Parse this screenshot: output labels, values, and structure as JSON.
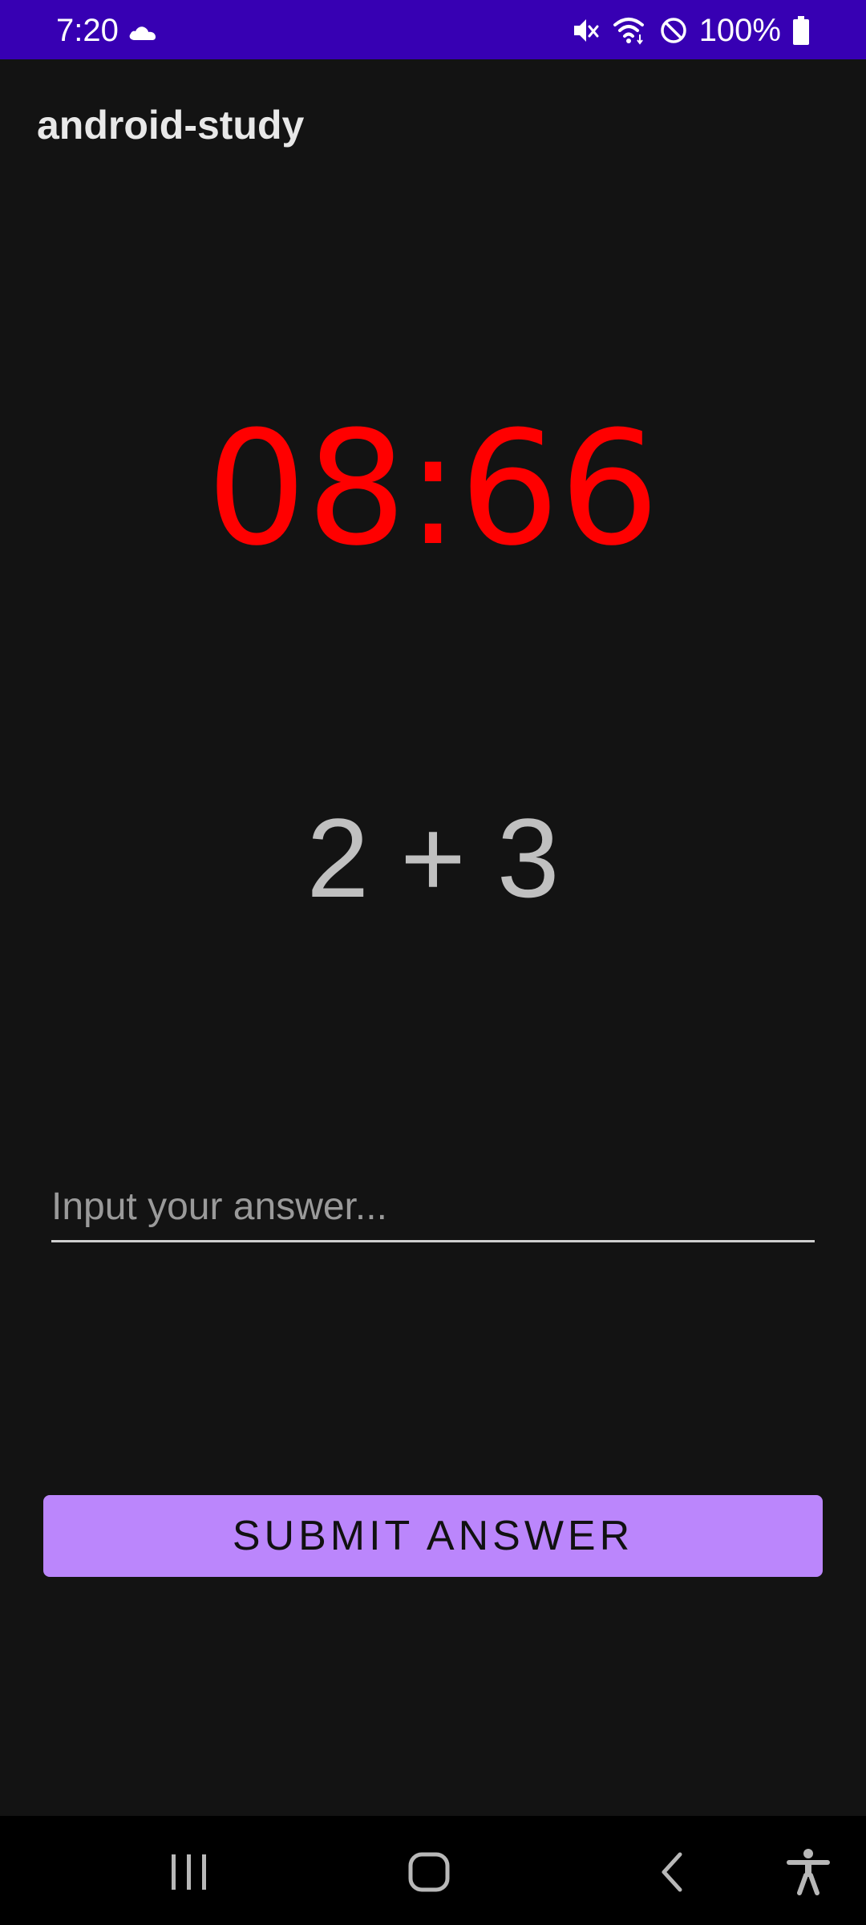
{
  "status_bar": {
    "time": "7:20",
    "battery": "100%",
    "background": "#3700b3",
    "icons": [
      "cloud-icon",
      "mute-icon",
      "wifi-icon",
      "do-not-disturb-icon",
      "battery-icon"
    ]
  },
  "app": {
    "title": "android-study"
  },
  "game": {
    "timer": "08:66",
    "timer_color": "#ff0000",
    "question": "2 + 3"
  },
  "answer": {
    "value": "",
    "placeholder": "Input your answer..."
  },
  "submit": {
    "label": "SUBMIT ANSWER",
    "color": "#bb86fc"
  },
  "nav_bar": {
    "icons": [
      "recent-apps-icon",
      "home-icon",
      "back-icon",
      "accessibility-icon"
    ]
  }
}
